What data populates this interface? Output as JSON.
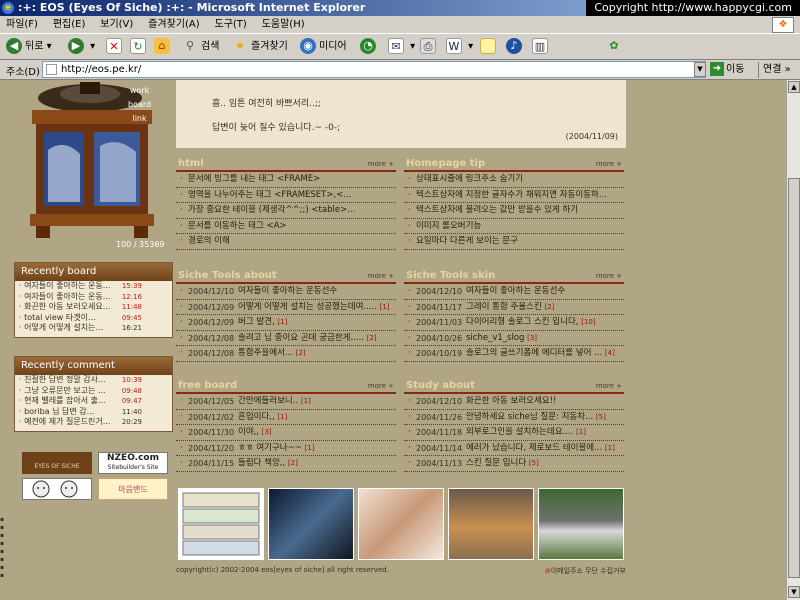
{
  "window": {
    "title": ":+: EOS (Eyes Of Siche) :+: - Microsoft Internet Explorer",
    "copyright": "Copyright  http://www.happycgi.com"
  },
  "menu": [
    "파일(F)",
    "편집(E)",
    "보기(V)",
    "즐겨찾기(A)",
    "도구(T)",
    "도움말(H)"
  ],
  "toolbar": {
    "back_label": "뒤로",
    "search_label": "검색",
    "favorites_label": "즐겨찾기",
    "media_label": "미디어"
  },
  "address": {
    "label": "주소(D)",
    "url": "http://eos.pe.kr/",
    "go_label": "이동",
    "links_label": "연결"
  },
  "site": {
    "nav": [
      "work",
      "board",
      "link"
    ],
    "visit_count": "100 / 35369",
    "post": {
      "lines": [
        "흠.. 임튼 여전히 바쁘서리..;;",
        "답변이 늦어 질수 있습니다.~ -0-;"
      ],
      "date": "(2004/11/09)"
    },
    "recent_board": {
      "title": "Recently board",
      "items": [
        {
          "text": "· 여자들이 좋아하는 운동...",
          "time": "15:39"
        },
        {
          "text": "· 여자들이 좋아하는 운동...",
          "time": "12:16"
        },
        {
          "text": "· 화끈한 아동 보러오세요...",
          "time": "11:48"
        },
        {
          "text": "· total view 타겟이...",
          "time": "09:45"
        },
        {
          "text": "· 어떻게 어떻게 설치는...",
          "time": "16:21"
        }
      ]
    },
    "recent_comment": {
      "title": "Recently comment",
      "items": [
        {
          "text": "· 친절한 답변 정말 감사...",
          "time": "10:39"
        },
        {
          "text": "· 그냥 오류문만 보고는 ...",
          "time": "09:48"
        },
        {
          "text": "· 현재 벨레를 잡아서 출...",
          "time": "09:47"
        },
        {
          "text": "· boriba 님 답변 감...",
          "time": "11:40"
        },
        {
          "text": "· 예전에 제가 질문드린거...",
          "time": "20:29"
        }
      ]
    },
    "logos": {
      "eos": "EYES OF SICHE",
      "nzeo": "NZEO.com",
      "nzeo_sub": "Sitebuilder's Site",
      "badge": "마음밴드"
    },
    "more_label": "more +",
    "html_section": {
      "title": "html",
      "items": [
        "문서에 빙그를 내는 태그 <FRAME>",
        "영역을 나누어주는 태그 <FRAMESET>,<...",
        "가장 중요한 테이블 (제생각^^;;) <table>...",
        "문서를 이동하는 태그 <A>",
        "경로의 이해"
      ]
    },
    "homepage_section": {
      "title": "Homepage tip",
      "items": [
        "상태표시줄에 링크주소 숨기기",
        "텍스트상자에 지정한 글자수가 채워지면 자동이동하...",
        "텍스트상자에 불려오는 값만 받을수 있게 하기",
        "이미지 롤오버기능",
        "요일마다 다른게 보이는 문구"
      ]
    },
    "tools_about": {
      "title": "Siche Tools about",
      "items": [
        {
          "date": "2004/12/10",
          "title": "여자들이 좋아하는 운동선수",
          "count": ""
        },
        {
          "date": "2004/12/09",
          "title": "어떻게 어떻게 설치는 성공했는데여.....",
          "count": "[1]"
        },
        {
          "date": "2004/12/09",
          "title": "버그 발견,",
          "count": "[1]"
        },
        {
          "date": "2004/12/08",
          "title": "솔려고 님 중이요 곤데 궁금한게.....",
          "count": "[2]"
        },
        {
          "date": "2004/12/08",
          "title": "통합주을에서...",
          "count": "[2]"
        }
      ]
    },
    "tools_skin": {
      "title": "Siche Tools skin",
      "items": [
        {
          "date": "2004/12/10",
          "title": "여자들이 좋아하는 운동선수",
          "count": ""
        },
        {
          "date": "2004/11/17",
          "title": "그레이 통합 주율스킨",
          "count": "[2]"
        },
        {
          "date": "2004/11/03",
          "title": "다이어리형 솔로그 스킨 입니다,",
          "count": "[10]"
        },
        {
          "date": "2004/10/26",
          "title": "siche_v1_slog",
          "count": "[3]"
        },
        {
          "date": "2004/10/19",
          "title": "솔로그의 글쓰기폼에 에디터를 넣어 ...",
          "count": "[4]"
        }
      ]
    },
    "free_board": {
      "title": "free board",
      "items": [
        {
          "date": "2004/12/05",
          "title": "간만에들러보니..",
          "count": "[1]"
        },
        {
          "date": "2004/12/02",
          "title": "흔입이다,,",
          "count": "[1]"
        },
        {
          "date": "2004/11/30",
          "title": "이야,,",
          "count": "[3]"
        },
        {
          "date": "2004/11/20",
          "title": "ㅎㅎ 여기구나~~",
          "count": "[1]"
        },
        {
          "date": "2004/11/15",
          "title": "들립다 책앙,,",
          "count": "[2]"
        }
      ]
    },
    "study_about": {
      "title": "Study about",
      "items": [
        {
          "date": "2004/12/10",
          "title": "화끈한 아동 보러오세요!!",
          "count": ""
        },
        {
          "date": "2004/11/26",
          "title": "안녕하세요 siche님 질문: 지동차...",
          "count": "[5]"
        },
        {
          "date": "2004/11/18",
          "title": "외부로그인을 설치하는데요....",
          "count": "[1]"
        },
        {
          "date": "2004/11/14",
          "title": "에러가 났습니다, 제로보드 테이블에...",
          "count": "[1]"
        },
        {
          "date": "2004/11/13",
          "title": "스킨 질문 입니다",
          "count": "[5]"
        }
      ]
    },
    "footer": {
      "copyright": "copyright(c) 2002-2004 eos[eyes of siche] all right reserved.",
      "email_notice": "이메일주소 무단 수집거부"
    }
  },
  "colors": {
    "page_bg": "#b0a585",
    "content_bg": "#ede5d0",
    "accent": "#8a2a0a",
    "section_title": "#e8d4a0"
  }
}
